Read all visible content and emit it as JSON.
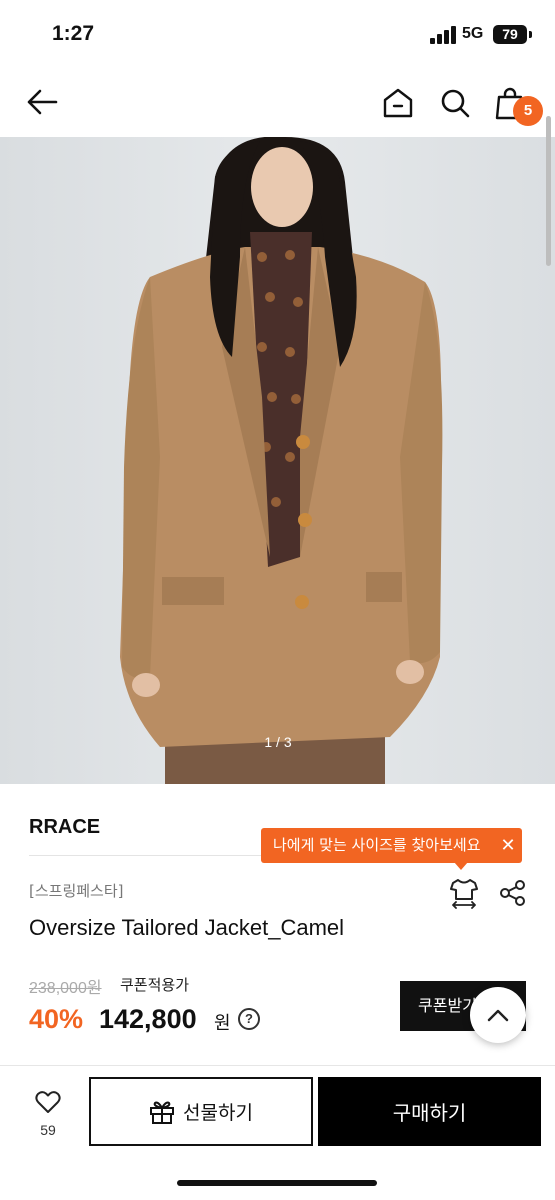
{
  "status": {
    "time": "1:27",
    "network": "5G",
    "battery": "79"
  },
  "header": {
    "cart_count": "5"
  },
  "gallery": {
    "indicator": "1 / 3"
  },
  "product": {
    "brand": "RRACE",
    "tag": "[스프링페스타]",
    "title": "Oversize Tailored Jacket_Camel",
    "original_price": "238,000원",
    "coupon_label": "쿠폰적용가",
    "discount": "40%",
    "price": "142,800",
    "currency": "원",
    "help_symbol": "?"
  },
  "tooltip": {
    "text": "나에게 맞는 사이즈를 찾아보세요",
    "close": "✕"
  },
  "coupon_button": {
    "label": "쿠폰받기"
  },
  "bottom_bar": {
    "like_count": "59",
    "gift_label": "선물하기",
    "buy_label": "구매하기"
  },
  "colors": {
    "accent": "#f26522",
    "camel": "#b98d63",
    "background": "#ffffff"
  }
}
